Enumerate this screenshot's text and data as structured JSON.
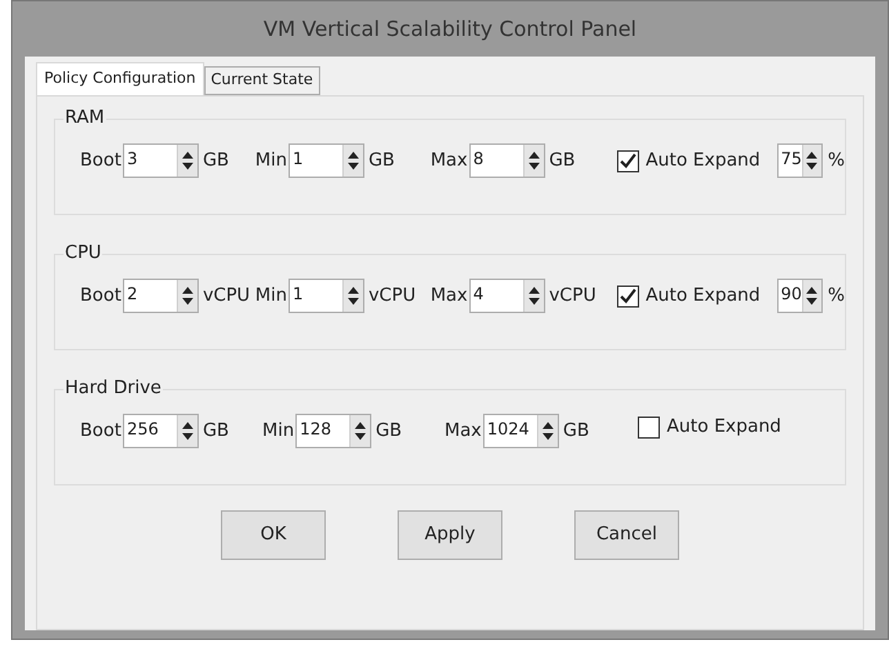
{
  "window": {
    "title": "VM Vertical Scalability Control Panel"
  },
  "tabs": [
    {
      "label": "Policy Configuration",
      "selected": true
    },
    {
      "label": "Current State",
      "selected": false
    }
  ],
  "groups": [
    {
      "title": "RAM",
      "fields": [
        {
          "label": "Boot",
          "value": "3",
          "unit": "GB"
        },
        {
          "label": "Min",
          "value": "1",
          "unit": "GB"
        },
        {
          "label": "Max",
          "value": "8",
          "unit": "GB"
        }
      ],
      "auto_expand": {
        "label": "Auto Expand",
        "checked": true,
        "threshold": "75",
        "threshold_unit": "%"
      }
    },
    {
      "title": "CPU",
      "fields": [
        {
          "label": "Boot",
          "value": "2",
          "unit": "vCPU"
        },
        {
          "label": "Min",
          "value": "1",
          "unit": "vCPU"
        },
        {
          "label": "Max",
          "value": "4",
          "unit": "vCPU"
        }
      ],
      "auto_expand": {
        "label": "Auto Expand",
        "checked": true,
        "threshold": "90",
        "threshold_unit": "%"
      }
    },
    {
      "title": "Hard Drive",
      "fields": [
        {
          "label": "Boot",
          "value": "256",
          "unit": "GB"
        },
        {
          "label": "Min",
          "value": "128",
          "unit": "GB"
        },
        {
          "label": "Max",
          "value": "1024",
          "unit": "GB"
        }
      ],
      "auto_expand": {
        "label": "Auto Expand",
        "checked": false
      }
    }
  ],
  "buttons": [
    "OK",
    "Apply",
    "Cancel"
  ]
}
